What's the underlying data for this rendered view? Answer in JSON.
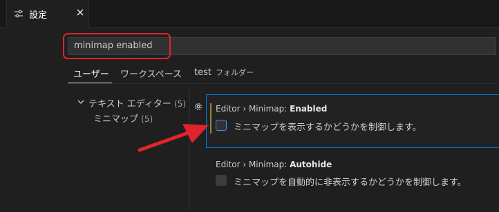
{
  "tab": {
    "label": "設定",
    "icon": "settings-sliders-icon"
  },
  "search": {
    "value": "minimap enabled"
  },
  "scopes": {
    "user": "ユーザー",
    "workspace": "ワークスペース",
    "folder_name": "test",
    "folder_label": "フォルダー"
  },
  "toc": {
    "group_label": "テキスト エディター",
    "group_count": "(5)",
    "item_label": "ミニマップ",
    "item_count": "(5)"
  },
  "settings": [
    {
      "category": "Editor › Minimap: ",
      "name": "Enabled",
      "description": "ミニマップを表示するかどうかを制御します。",
      "checked": false
    },
    {
      "category": "Editor › Minimap: ",
      "name": "Autohide",
      "description": "ミニマップを自動的に非表示するかどうかを制御します。",
      "checked": false
    }
  ],
  "colors": {
    "accent": "#0078d4",
    "annotation": "#e0242b",
    "modified_indicator": "#a0823b",
    "background": "#1f1f1f"
  }
}
